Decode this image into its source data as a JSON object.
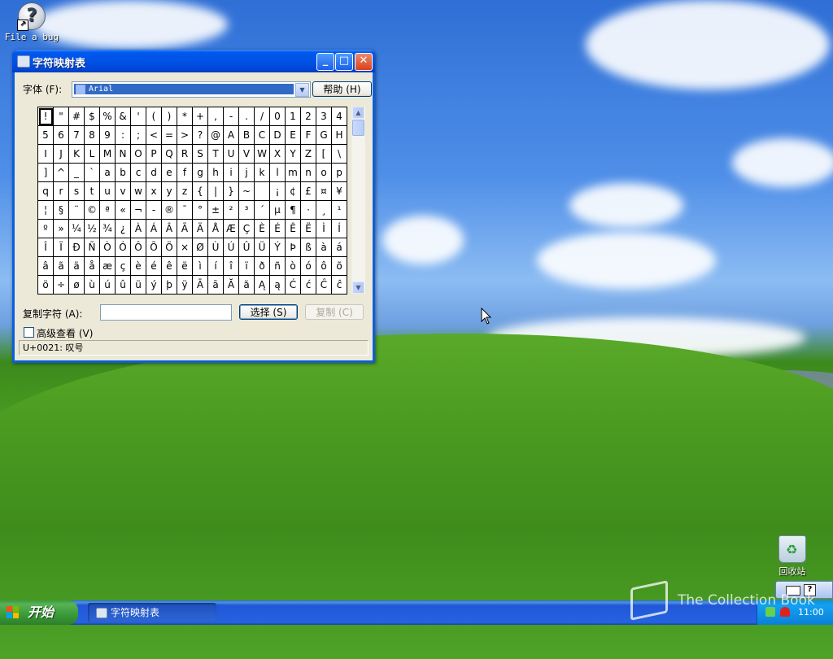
{
  "desktop": {
    "icons": [
      {
        "label": "File a bug"
      },
      {
        "label": "回收站"
      }
    ],
    "watermark": "The Collection Book"
  },
  "window": {
    "title": "字符映射表",
    "font_label": "字体 (F):",
    "font_value": "Arial",
    "help_button": "帮助 (H)",
    "copy_label": "复制字符 (A):",
    "copy_value": "",
    "select_button": "选择 (S)",
    "copy_button": "复制 (C)",
    "advanced_label": "高级查看 (V)",
    "status": "U+0021: 叹号",
    "grid": [
      [
        "!",
        "\"",
        "#",
        "$",
        "%",
        "&",
        "'",
        "(",
        ")",
        "*",
        "+",
        ",",
        "-",
        ".",
        "/",
        "0",
        "1",
        "2",
        "3",
        "4"
      ],
      [
        "5",
        "6",
        "7",
        "8",
        "9",
        ":",
        ";",
        "<",
        "=",
        ">",
        "?",
        "@",
        "A",
        "B",
        "C",
        "D",
        "E",
        "F",
        "G",
        "H"
      ],
      [
        "I",
        "J",
        "K",
        "L",
        "M",
        "N",
        "O",
        "P",
        "Q",
        "R",
        "S",
        "T",
        "U",
        "V",
        "W",
        "X",
        "Y",
        "Z",
        "[",
        "\\"
      ],
      [
        "]",
        "^",
        "_",
        "`",
        "a",
        "b",
        "c",
        "d",
        "e",
        "f",
        "g",
        "h",
        "i",
        "j",
        "k",
        "l",
        "m",
        "n",
        "o",
        "p"
      ],
      [
        "q",
        "r",
        "s",
        "t",
        "u",
        "v",
        "w",
        "x",
        "y",
        "z",
        "{",
        "|",
        "}",
        "~",
        " ",
        "¡",
        "¢",
        "£",
        "¤",
        "¥"
      ],
      [
        "¦",
        "§",
        "¨",
        "©",
        "ª",
        "«",
        "¬",
        "-",
        "®",
        "¯",
        "°",
        "±",
        "²",
        "³",
        "´",
        "µ",
        "¶",
        "·",
        "¸",
        "¹"
      ],
      [
        "º",
        "»",
        "¼",
        "½",
        "¾",
        "¿",
        "À",
        "Á",
        "Â",
        "Ã",
        "Ä",
        "Å",
        "Æ",
        "Ç",
        "È",
        "É",
        "Ê",
        "Ë",
        "Ì",
        "Í"
      ],
      [
        "Î",
        "Ï",
        "Ð",
        "Ñ",
        "Ò",
        "Ó",
        "Ô",
        "Õ",
        "Ö",
        "×",
        "Ø",
        "Ù",
        "Ú",
        "Û",
        "Ü",
        "Ý",
        "Þ",
        "ß",
        "à",
        "á"
      ],
      [
        "â",
        "ã",
        "ä",
        "å",
        "æ",
        "ç",
        "è",
        "é",
        "ê",
        "ë",
        "ì",
        "í",
        "î",
        "ï",
        "ð",
        "ñ",
        "ò",
        "ó",
        "ô",
        "õ"
      ],
      [
        "ö",
        "÷",
        "ø",
        "ù",
        "ú",
        "û",
        "ü",
        "ý",
        "þ",
        "ÿ",
        "Ā",
        "ā",
        "Ă",
        "ă",
        "Ą",
        "ą",
        "Ć",
        "ć",
        "Ĉ",
        "ĉ"
      ]
    ]
  },
  "taskbar": {
    "start_label": "开始",
    "tasks": [
      {
        "label": "字符映射表"
      }
    ],
    "clock": "11:00",
    "langbar_help": "?"
  },
  "colors": {
    "title_blue": "#0053e6",
    "start_green": "#3a9a37",
    "selection": "#316ac5"
  }
}
